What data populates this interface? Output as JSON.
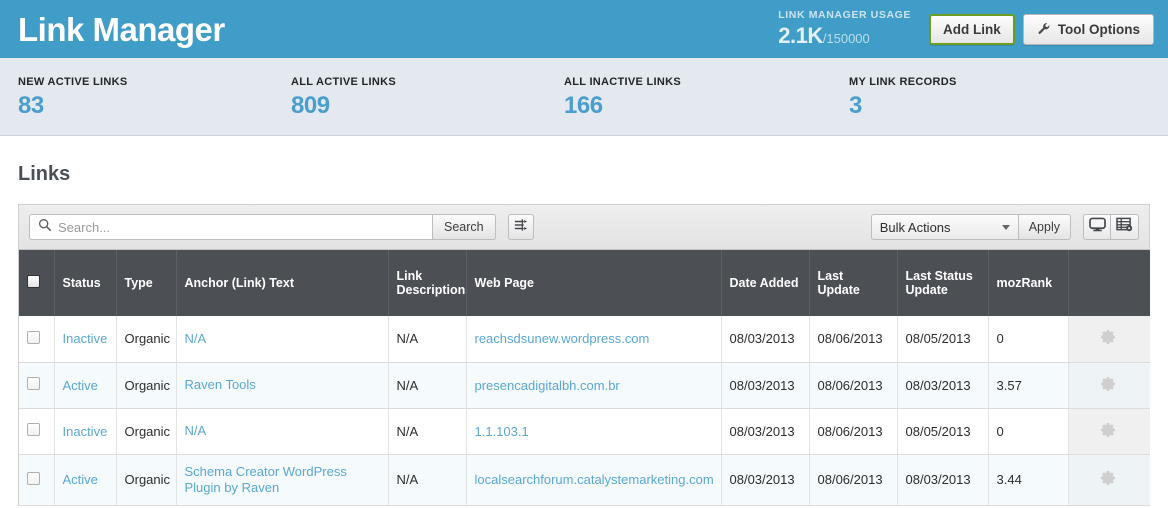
{
  "header": {
    "title": "Link Manager",
    "usage_label": "LINK MANAGER USAGE",
    "usage_current": "2.1K",
    "usage_max": "/150000",
    "add_link_label": "Add Link",
    "tool_options_label": "Tool Options",
    "accent_color": "#3f9dc8",
    "add_link_border_color": "#6d9c1e"
  },
  "stats": [
    {
      "label": "NEW ACTIVE LINKS",
      "value": "83"
    },
    {
      "label": "ALL ACTIVE LINKS",
      "value": "809"
    },
    {
      "label": "ALL INACTIVE LINKS",
      "value": "166"
    },
    {
      "label": "MY LINK RECORDS",
      "value": "3"
    }
  ],
  "stats_value_color": "#4a9ecb",
  "main": {
    "section_title": "Links"
  },
  "toolbar": {
    "search_placeholder": "Search...",
    "search_value": "",
    "search_button_label": "Search",
    "filter_icon": "sliders-icon",
    "bulk_actions_label": "Bulk Actions",
    "apply_label": "Apply",
    "view_monitor_icon": "monitor-icon",
    "view_table_settings_icon": "table-settings-icon"
  },
  "table": {
    "columns": [
      "",
      "Status",
      "Type",
      "Anchor (Link) Text",
      "Link Description",
      "Web Page",
      "Date Added",
      "Last Update",
      "Last Status Update",
      "mozRank",
      ""
    ],
    "rows": [
      {
        "status": "Inactive",
        "type": "Organic",
        "anchor": "N/A",
        "description": "N/A",
        "webpage": "reachsdsunew.wordpress.com",
        "date_added": "08/03/2013",
        "last_update": "08/06/2013",
        "last_status_update": "08/05/2013",
        "mozrank": "0"
      },
      {
        "status": "Active",
        "type": "Organic",
        "anchor": "Raven Tools",
        "description": "N/A",
        "webpage": "presencadigitalbh.com.br",
        "date_added": "08/03/2013",
        "last_update": "08/06/2013",
        "last_status_update": "08/03/2013",
        "mozrank": "3.57"
      },
      {
        "status": "Inactive",
        "type": "Organic",
        "anchor": "N/A",
        "description": "N/A",
        "webpage": "1.1.103.1",
        "date_added": "08/03/2013",
        "last_update": "08/06/2013",
        "last_status_update": "08/05/2013",
        "mozrank": "0"
      },
      {
        "status": "Active",
        "type": "Organic",
        "anchor": "Schema Creator WordPress Plugin by Raven",
        "description": "N/A",
        "webpage": "localsearchforum.catalystemarketing.com",
        "date_added": "08/03/2013",
        "last_update": "08/06/2013",
        "last_status_update": "08/03/2013",
        "mozrank": "3.44"
      }
    ],
    "row_action_icon": "gear-icon",
    "link_color": "#5aa7d4"
  }
}
